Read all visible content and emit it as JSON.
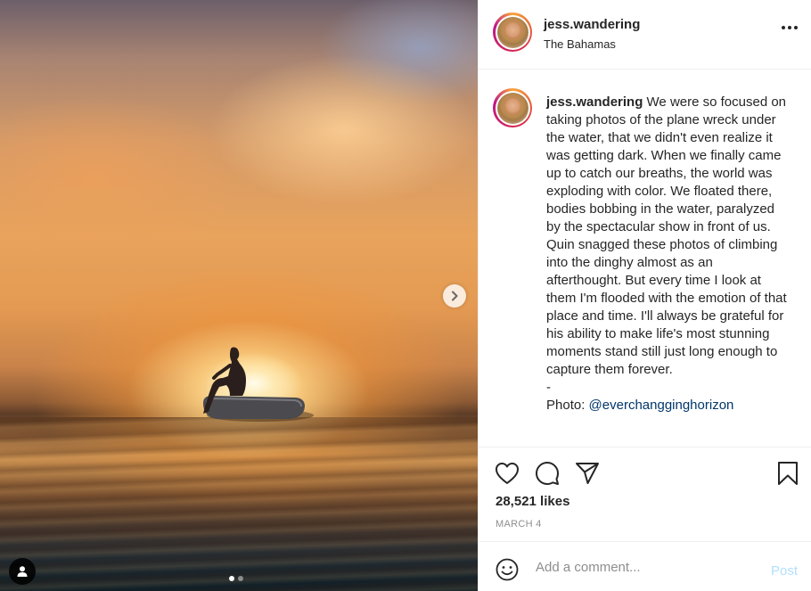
{
  "media": {
    "carousel_count": 2,
    "active_index": 0
  },
  "post": {
    "username": "jess.wandering",
    "location": "The Bahamas",
    "caption": "We were so focused on taking photos of the plane wreck under the water, that we didn't even realize it was getting dark. When we finally came up to catch our breaths, the world was exploding with color. We floated there, bodies bobbing in the water, paralyzed by the spectacular show in front of us. Quin snagged these photos of climbing into the dinghy almost as an afterthought. But every time I look at them I'm flooded with the emotion of that place and time. I'll always be grateful for his ability to make life's most stunning moments stand still just long enough to capture them forever.\n-",
    "photo_credit_label": "Photo: ",
    "photo_credit_handle": "@everchangginghorizon",
    "likes": "28,521 likes",
    "date": "MARCH 4"
  },
  "comment_box": {
    "placeholder": "Add a comment...",
    "post_label": "Post"
  },
  "colors": {
    "accent": "#0095f6",
    "post_disabled": "#b2dffc",
    "text": "#262626",
    "muted": "#8e8e8e"
  },
  "icons": {
    "like": "heart-icon",
    "comment": "comment-icon",
    "share": "paper-plane-icon",
    "save": "bookmark-icon",
    "more": "more-options-icon",
    "emoji": "emoji-icon",
    "next": "chevron-right-icon",
    "tags": "user-tag-icon"
  }
}
